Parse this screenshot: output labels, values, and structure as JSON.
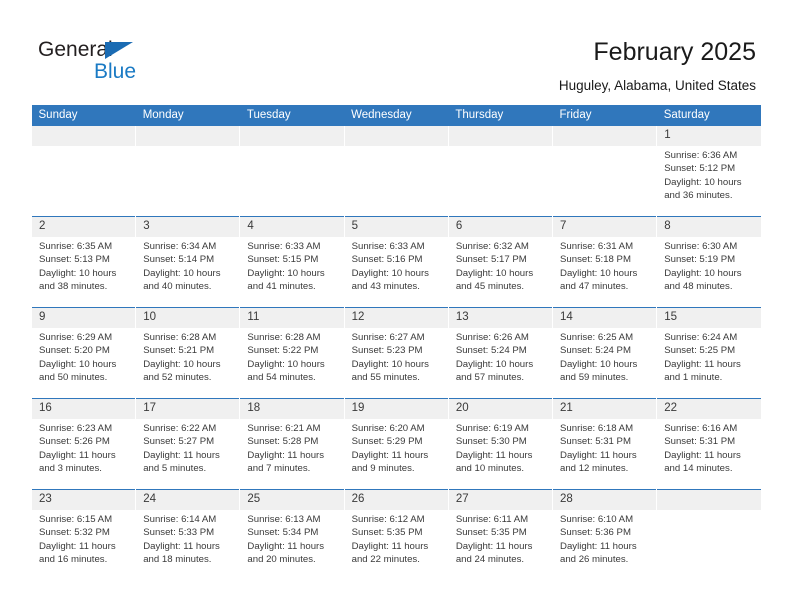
{
  "brand": {
    "name_top": "General",
    "name_bottom": "Blue",
    "color_dark": "#231f20",
    "color_blue": "#1a7ac4"
  },
  "header": {
    "title": "February 2025",
    "subtitle": "Huguley, Alabama, United States"
  },
  "theme": {
    "header_blue": "#3077bc",
    "daynum_gray": "#f0f0f0",
    "text": "#3a3a3a"
  },
  "calendar": {
    "weekday_headers": [
      "Sunday",
      "Monday",
      "Tuesday",
      "Wednesday",
      "Thursday",
      "Friday",
      "Saturday"
    ],
    "labels": {
      "sunrise": "Sunrise:",
      "sunset": "Sunset:",
      "daylight": "Daylight:"
    },
    "weeks": [
      [
        {
          "day": "",
          "sunrise": "",
          "sunset": "",
          "daylight1": "",
          "daylight2": ""
        },
        {
          "day": "",
          "sunrise": "",
          "sunset": "",
          "daylight1": "",
          "daylight2": ""
        },
        {
          "day": "",
          "sunrise": "",
          "sunset": "",
          "daylight1": "",
          "daylight2": ""
        },
        {
          "day": "",
          "sunrise": "",
          "sunset": "",
          "daylight1": "",
          "daylight2": ""
        },
        {
          "day": "",
          "sunrise": "",
          "sunset": "",
          "daylight1": "",
          "daylight2": ""
        },
        {
          "day": "",
          "sunrise": "",
          "sunset": "",
          "daylight1": "",
          "daylight2": ""
        },
        {
          "day": "1",
          "sunrise": "Sunrise: 6:36 AM",
          "sunset": "Sunset: 5:12 PM",
          "daylight1": "Daylight: 10 hours",
          "daylight2": "and 36 minutes."
        }
      ],
      [
        {
          "day": "2",
          "sunrise": "Sunrise: 6:35 AM",
          "sunset": "Sunset: 5:13 PM",
          "daylight1": "Daylight: 10 hours",
          "daylight2": "and 38 minutes."
        },
        {
          "day": "3",
          "sunrise": "Sunrise: 6:34 AM",
          "sunset": "Sunset: 5:14 PM",
          "daylight1": "Daylight: 10 hours",
          "daylight2": "and 40 minutes."
        },
        {
          "day": "4",
          "sunrise": "Sunrise: 6:33 AM",
          "sunset": "Sunset: 5:15 PM",
          "daylight1": "Daylight: 10 hours",
          "daylight2": "and 41 minutes."
        },
        {
          "day": "5",
          "sunrise": "Sunrise: 6:33 AM",
          "sunset": "Sunset: 5:16 PM",
          "daylight1": "Daylight: 10 hours",
          "daylight2": "and 43 minutes."
        },
        {
          "day": "6",
          "sunrise": "Sunrise: 6:32 AM",
          "sunset": "Sunset: 5:17 PM",
          "daylight1": "Daylight: 10 hours",
          "daylight2": "and 45 minutes."
        },
        {
          "day": "7",
          "sunrise": "Sunrise: 6:31 AM",
          "sunset": "Sunset: 5:18 PM",
          "daylight1": "Daylight: 10 hours",
          "daylight2": "and 47 minutes."
        },
        {
          "day": "8",
          "sunrise": "Sunrise: 6:30 AM",
          "sunset": "Sunset: 5:19 PM",
          "daylight1": "Daylight: 10 hours",
          "daylight2": "and 48 minutes."
        }
      ],
      [
        {
          "day": "9",
          "sunrise": "Sunrise: 6:29 AM",
          "sunset": "Sunset: 5:20 PM",
          "daylight1": "Daylight: 10 hours",
          "daylight2": "and 50 minutes."
        },
        {
          "day": "10",
          "sunrise": "Sunrise: 6:28 AM",
          "sunset": "Sunset: 5:21 PM",
          "daylight1": "Daylight: 10 hours",
          "daylight2": "and 52 minutes."
        },
        {
          "day": "11",
          "sunrise": "Sunrise: 6:28 AM",
          "sunset": "Sunset: 5:22 PM",
          "daylight1": "Daylight: 10 hours",
          "daylight2": "and 54 minutes."
        },
        {
          "day": "12",
          "sunrise": "Sunrise: 6:27 AM",
          "sunset": "Sunset: 5:23 PM",
          "daylight1": "Daylight: 10 hours",
          "daylight2": "and 55 minutes."
        },
        {
          "day": "13",
          "sunrise": "Sunrise: 6:26 AM",
          "sunset": "Sunset: 5:24 PM",
          "daylight1": "Daylight: 10 hours",
          "daylight2": "and 57 minutes."
        },
        {
          "day": "14",
          "sunrise": "Sunrise: 6:25 AM",
          "sunset": "Sunset: 5:24 PM",
          "daylight1": "Daylight: 10 hours",
          "daylight2": "and 59 minutes."
        },
        {
          "day": "15",
          "sunrise": "Sunrise: 6:24 AM",
          "sunset": "Sunset: 5:25 PM",
          "daylight1": "Daylight: 11 hours",
          "daylight2": "and 1 minute."
        }
      ],
      [
        {
          "day": "16",
          "sunrise": "Sunrise: 6:23 AM",
          "sunset": "Sunset: 5:26 PM",
          "daylight1": "Daylight: 11 hours",
          "daylight2": "and 3 minutes."
        },
        {
          "day": "17",
          "sunrise": "Sunrise: 6:22 AM",
          "sunset": "Sunset: 5:27 PM",
          "daylight1": "Daylight: 11 hours",
          "daylight2": "and 5 minutes."
        },
        {
          "day": "18",
          "sunrise": "Sunrise: 6:21 AM",
          "sunset": "Sunset: 5:28 PM",
          "daylight1": "Daylight: 11 hours",
          "daylight2": "and 7 minutes."
        },
        {
          "day": "19",
          "sunrise": "Sunrise: 6:20 AM",
          "sunset": "Sunset: 5:29 PM",
          "daylight1": "Daylight: 11 hours",
          "daylight2": "and 9 minutes."
        },
        {
          "day": "20",
          "sunrise": "Sunrise: 6:19 AM",
          "sunset": "Sunset: 5:30 PM",
          "daylight1": "Daylight: 11 hours",
          "daylight2": "and 10 minutes."
        },
        {
          "day": "21",
          "sunrise": "Sunrise: 6:18 AM",
          "sunset": "Sunset: 5:31 PM",
          "daylight1": "Daylight: 11 hours",
          "daylight2": "and 12 minutes."
        },
        {
          "day": "22",
          "sunrise": "Sunrise: 6:16 AM",
          "sunset": "Sunset: 5:31 PM",
          "daylight1": "Daylight: 11 hours",
          "daylight2": "and 14 minutes."
        }
      ],
      [
        {
          "day": "23",
          "sunrise": "Sunrise: 6:15 AM",
          "sunset": "Sunset: 5:32 PM",
          "daylight1": "Daylight: 11 hours",
          "daylight2": "and 16 minutes."
        },
        {
          "day": "24",
          "sunrise": "Sunrise: 6:14 AM",
          "sunset": "Sunset: 5:33 PM",
          "daylight1": "Daylight: 11 hours",
          "daylight2": "and 18 minutes."
        },
        {
          "day": "25",
          "sunrise": "Sunrise: 6:13 AM",
          "sunset": "Sunset: 5:34 PM",
          "daylight1": "Daylight: 11 hours",
          "daylight2": "and 20 minutes."
        },
        {
          "day": "26",
          "sunrise": "Sunrise: 6:12 AM",
          "sunset": "Sunset: 5:35 PM",
          "daylight1": "Daylight: 11 hours",
          "daylight2": "and 22 minutes."
        },
        {
          "day": "27",
          "sunrise": "Sunrise: 6:11 AM",
          "sunset": "Sunset: 5:35 PM",
          "daylight1": "Daylight: 11 hours",
          "daylight2": "and 24 minutes."
        },
        {
          "day": "28",
          "sunrise": "Sunrise: 6:10 AM",
          "sunset": "Sunset: 5:36 PM",
          "daylight1": "Daylight: 11 hours",
          "daylight2": "and 26 minutes."
        },
        {
          "day": "",
          "sunrise": "",
          "sunset": "",
          "daylight1": "",
          "daylight2": ""
        }
      ]
    ]
  }
}
